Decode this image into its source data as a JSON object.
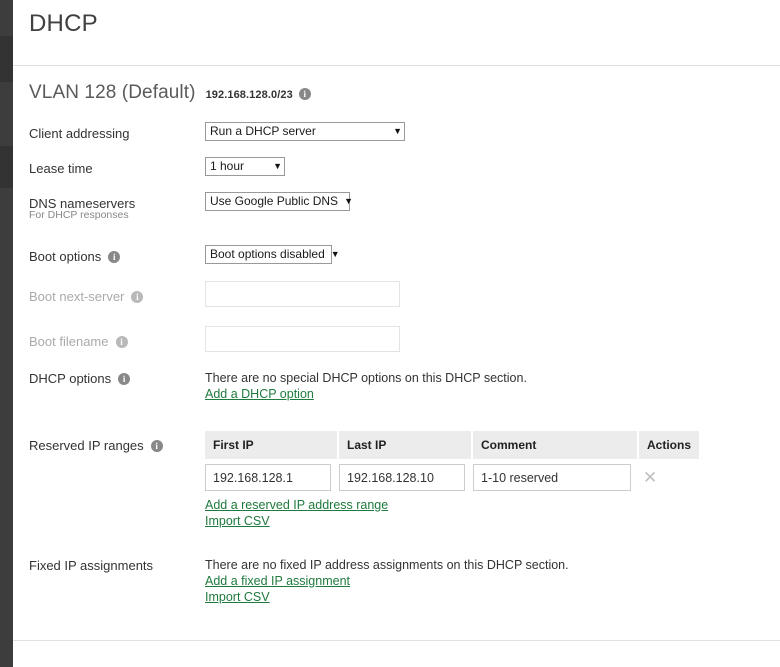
{
  "page": {
    "title": "DHCP"
  },
  "section": {
    "vlan_name": "VLAN 128 (Default)",
    "subnet": "192.168.128.0/23",
    "info_icon": "info-icon"
  },
  "fields": {
    "client_addressing": {
      "label": "Client addressing",
      "value": "Run a DHCP server",
      "options": [
        "Run a DHCP server"
      ]
    },
    "lease_time": {
      "label": "Lease time",
      "value": "1 hour",
      "options": [
        "1 hour"
      ]
    },
    "dns_nameservers": {
      "label": "DNS nameservers",
      "sublabel": "For DHCP responses",
      "value": "Use Google Public DNS",
      "options": [
        "Use Google Public DNS"
      ]
    },
    "boot_options": {
      "label": "Boot options",
      "value": "Boot options disabled",
      "options": [
        "Boot options disabled"
      ]
    },
    "boot_next_server": {
      "label": "Boot next-server",
      "value": "",
      "placeholder": ""
    },
    "boot_filename": {
      "label": "Boot filename",
      "value": "",
      "placeholder": ""
    },
    "dhcp_options": {
      "label": "DHCP options",
      "empty_text": "There are no special DHCP options on this DHCP section.",
      "add_link": "Add a DHCP option"
    },
    "reserved_ip_ranges": {
      "label": "Reserved IP ranges",
      "columns": [
        "First IP",
        "Last IP",
        "Comment",
        "Actions"
      ],
      "rows": [
        {
          "first_ip": "192.168.128.1",
          "last_ip": "192.168.128.10",
          "comment": "1-10 reserved",
          "action": "✕"
        }
      ],
      "add_link": "Add a reserved IP address range",
      "import_link": "Import CSV"
    },
    "fixed_ip_assignments": {
      "label": "Fixed IP assignments",
      "empty_text": "There are no fixed IP address assignments on this DHCP section.",
      "add_link": "Add a fixed IP assignment",
      "import_link": "Import CSV"
    }
  },
  "colors": {
    "link_green": "#1f7a3d",
    "nav_dark": "#3d3d3d",
    "table_header": "#ececec"
  }
}
